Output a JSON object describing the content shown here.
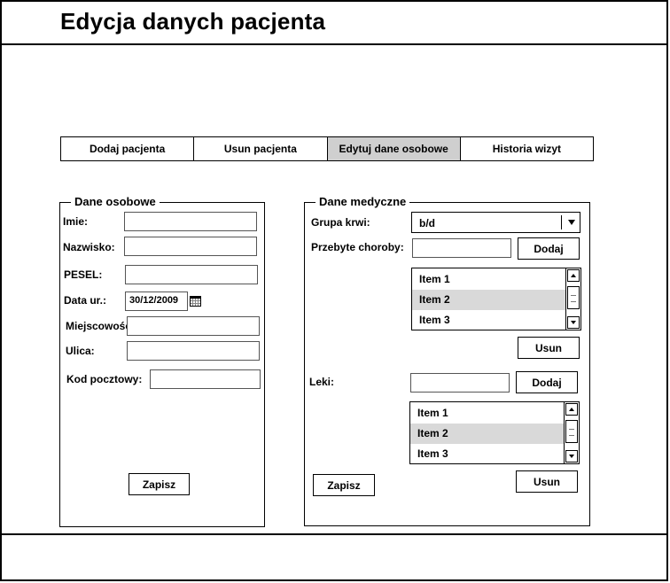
{
  "header": {
    "title": "Edycja danych pacjenta"
  },
  "tabs": [
    {
      "label": "Dodaj pacjenta"
    },
    {
      "label": "Usun pacjenta"
    },
    {
      "label": "Edytuj dane osobowe",
      "active": true
    },
    {
      "label": "Historia wizyt"
    }
  ],
  "personal": {
    "legend": "Dane osobowe",
    "first_name_label": "Imie:",
    "last_name_label": "Nazwisko:",
    "pesel_label": "PESEL:",
    "birth_date_label": "Data ur.:",
    "birth_date_value": "30/12/2009",
    "city_label": "Miejscowość:",
    "street_label": "Ulica:",
    "postal_code_label": "Kod pocztowy:",
    "save_label": "Zapisz"
  },
  "medical": {
    "legend": "Dane medyczne",
    "blood_group_label": "Grupa krwi:",
    "blood_group_value": "b/d",
    "diseases_label": "Przebyte choroby:",
    "diseases_add_label": "Dodaj",
    "diseases_items": [
      {
        "label": "Item 1"
      },
      {
        "label": "Item 2",
        "selected": true
      },
      {
        "label": "Item 3"
      }
    ],
    "diseases_remove_label": "Usun",
    "drugs_label": "Leki:",
    "drugs_add_label": "Dodaj",
    "drugs_items": [
      {
        "label": "Item 1"
      },
      {
        "label": "Item 2",
        "selected": true
      },
      {
        "label": "Item 3"
      }
    ],
    "drugs_remove_label": "Usun",
    "save_label": "Zapisz"
  },
  "colors": {
    "active_tab": "#cfcfcf",
    "selected_item": "#d9d9d9",
    "border": "#000000"
  }
}
